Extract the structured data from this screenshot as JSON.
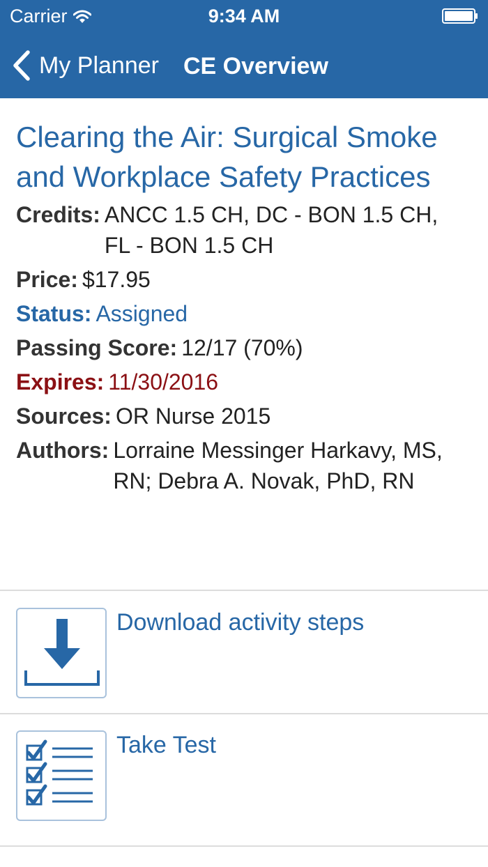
{
  "status_bar": {
    "carrier": "Carrier",
    "time": "9:34 AM"
  },
  "nav": {
    "back_label": "My Planner",
    "title": "CE Overview"
  },
  "course": {
    "title": "Clearing the Air: Surgical Smoke and Workplace Safety Practices",
    "credits_label": "Credits:",
    "credits": "ANCC 1.5 CH, DC - BON 1.5 CH, FL - BON 1.5 CH",
    "price_label": "Price:",
    "price": "$17.95",
    "status_label": "Status:",
    "status": "Assigned",
    "passing_label": "Passing Score:",
    "passing": "12/17 (70%)",
    "expires_label": "Expires:",
    "expires": "11/30/2016",
    "sources_label": "Sources:",
    "sources": "OR Nurse 2015",
    "authors_label": "Authors:",
    "authors": "Lorraine Messinger Harkavy, MS, RN; Debra A. Novak, PhD, RN"
  },
  "actions": [
    {
      "label": "Download activity steps",
      "icon": "download-icon"
    },
    {
      "label": "Take Test",
      "icon": "checklist-icon"
    }
  ],
  "colors": {
    "brand": "#2767a6",
    "expires": "#8b1014"
  }
}
